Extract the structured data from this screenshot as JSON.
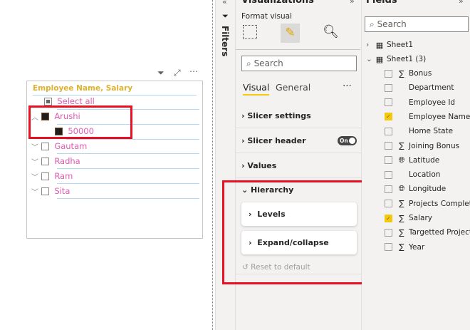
{
  "slicer": {
    "header": "Employee Name, Salary",
    "items": [
      {
        "label": "Select all",
        "state": "partial"
      },
      {
        "label": "Arushi",
        "state": "checked",
        "expanded": true
      },
      {
        "label": "50000",
        "state": "checked",
        "level": 2
      },
      {
        "label": "Gautam",
        "state": "unchecked"
      },
      {
        "label": "Radha",
        "state": "unchecked"
      },
      {
        "label": "Ram",
        "state": "unchecked"
      },
      {
        "label": "Sita",
        "state": "unchecked"
      }
    ]
  },
  "filters": {
    "label": "Filters"
  },
  "viz": {
    "title": "Visualizations",
    "subtitle": "Format visual",
    "search_placeholder": "Search",
    "tabs": [
      "Visual",
      "General"
    ],
    "active_tab": "Visual",
    "sections": [
      "Slicer settings",
      "Slicer header",
      "Values",
      "Hierarchy"
    ],
    "toggle": "On",
    "cards": [
      "Levels",
      "Expand/collapse"
    ],
    "reset": "Reset to default"
  },
  "fields": {
    "title": "Fields",
    "search_placeholder": "Search",
    "tables": [
      "Sheet1",
      "Sheet1 (3)"
    ],
    "items": [
      {
        "label": "Bonus",
        "icon": "sigma",
        "checked": false
      },
      {
        "label": "Department",
        "icon": "",
        "checked": false
      },
      {
        "label": "Employee Id",
        "icon": "",
        "checked": false
      },
      {
        "label": "Employee Name",
        "icon": "",
        "checked": true
      },
      {
        "label": "Home State",
        "icon": "",
        "checked": false
      },
      {
        "label": "Joining Bonus",
        "icon": "sigma",
        "checked": false
      },
      {
        "label": "Latitude",
        "icon": "globe",
        "checked": false
      },
      {
        "label": "Location",
        "icon": "",
        "checked": false
      },
      {
        "label": "Longitude",
        "icon": "globe",
        "checked": false
      },
      {
        "label": "Projects Complet...",
        "icon": "sigma",
        "checked": false
      },
      {
        "label": "Salary",
        "icon": "sigma",
        "checked": true
      },
      {
        "label": "Targetted Projects",
        "icon": "sigma",
        "checked": false
      },
      {
        "label": "Year",
        "icon": "sigma",
        "checked": false
      }
    ]
  },
  "colors": {
    "accent": "#f2c811",
    "highlight": "#e81123",
    "item_text": "#e05bb1",
    "header_text": "#e0b12a"
  }
}
